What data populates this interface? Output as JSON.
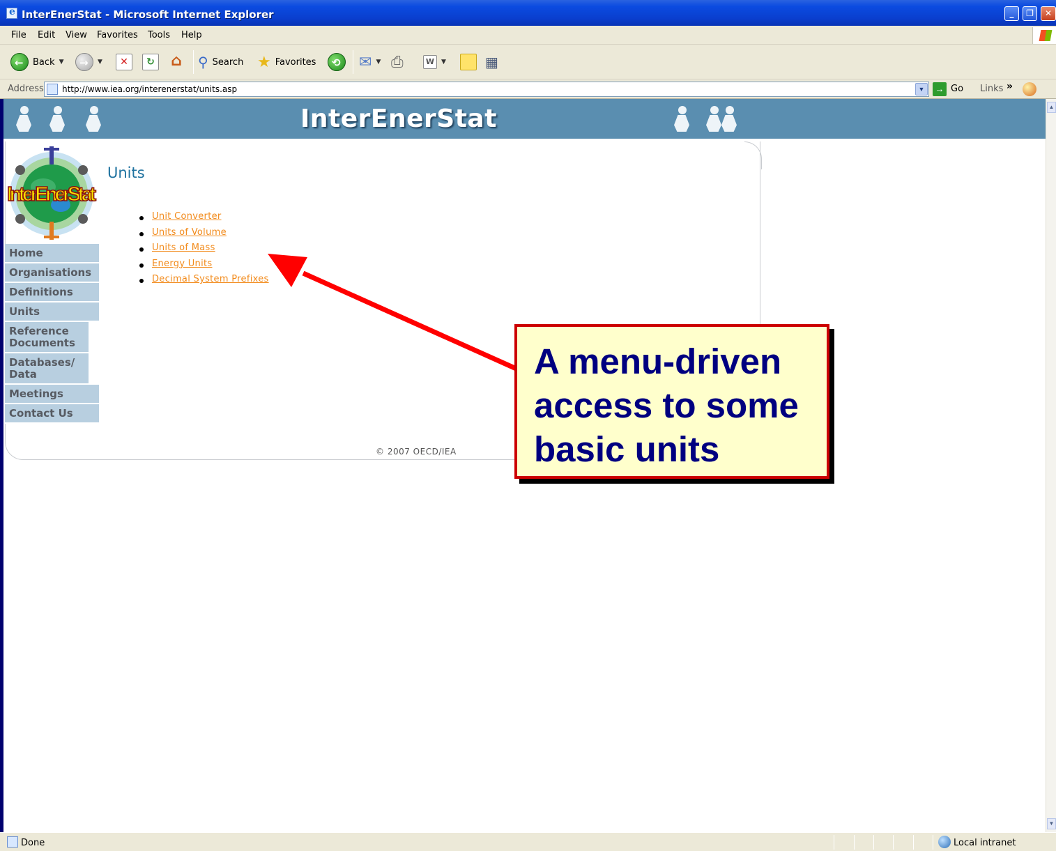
{
  "window": {
    "title": "InterEnerStat - Microsoft Internet Explorer",
    "min_glyph": "_",
    "max_glyph": "❐",
    "close_glyph": "✕"
  },
  "menubar": {
    "items": [
      "File",
      "Edit",
      "View",
      "Favorites",
      "Tools",
      "Help"
    ]
  },
  "toolbar": {
    "back_label": "Back",
    "search_label": "Search",
    "favorites_label": "Favorites"
  },
  "address": {
    "label": "Address",
    "url": "http://www.iea.org/interenerstat/units.asp",
    "go_label": "Go",
    "links_label": "Links",
    "links_chevron": "»"
  },
  "site": {
    "banner_title": "InterEnerStat",
    "nav": [
      "Home",
      "Organisations",
      "Definitions",
      "Units",
      "Reference Documents",
      "Databases/ Data",
      "Meetings",
      "Contact Us"
    ],
    "heading": "Units",
    "links": [
      "Unit Converter",
      "Units of Volume",
      "Units of Mass",
      "Energy Units",
      "Decimal System Prefixes"
    ],
    "copyright": "© 2007 OECD/IEA"
  },
  "annotation": {
    "callout_lines": [
      "A menu-driven",
      "access to some",
      "basic units"
    ],
    "border_color": "#cc0000",
    "fill_color": "#ffffcc",
    "text_color": "#000080"
  },
  "statusbar": {
    "status": "Done",
    "zone": "Local intranet"
  },
  "colors": {
    "banner": "#5a8eb0",
    "nav_bg": "#b8cfe0",
    "link": "#f28a1a",
    "heading": "#2073a0"
  }
}
